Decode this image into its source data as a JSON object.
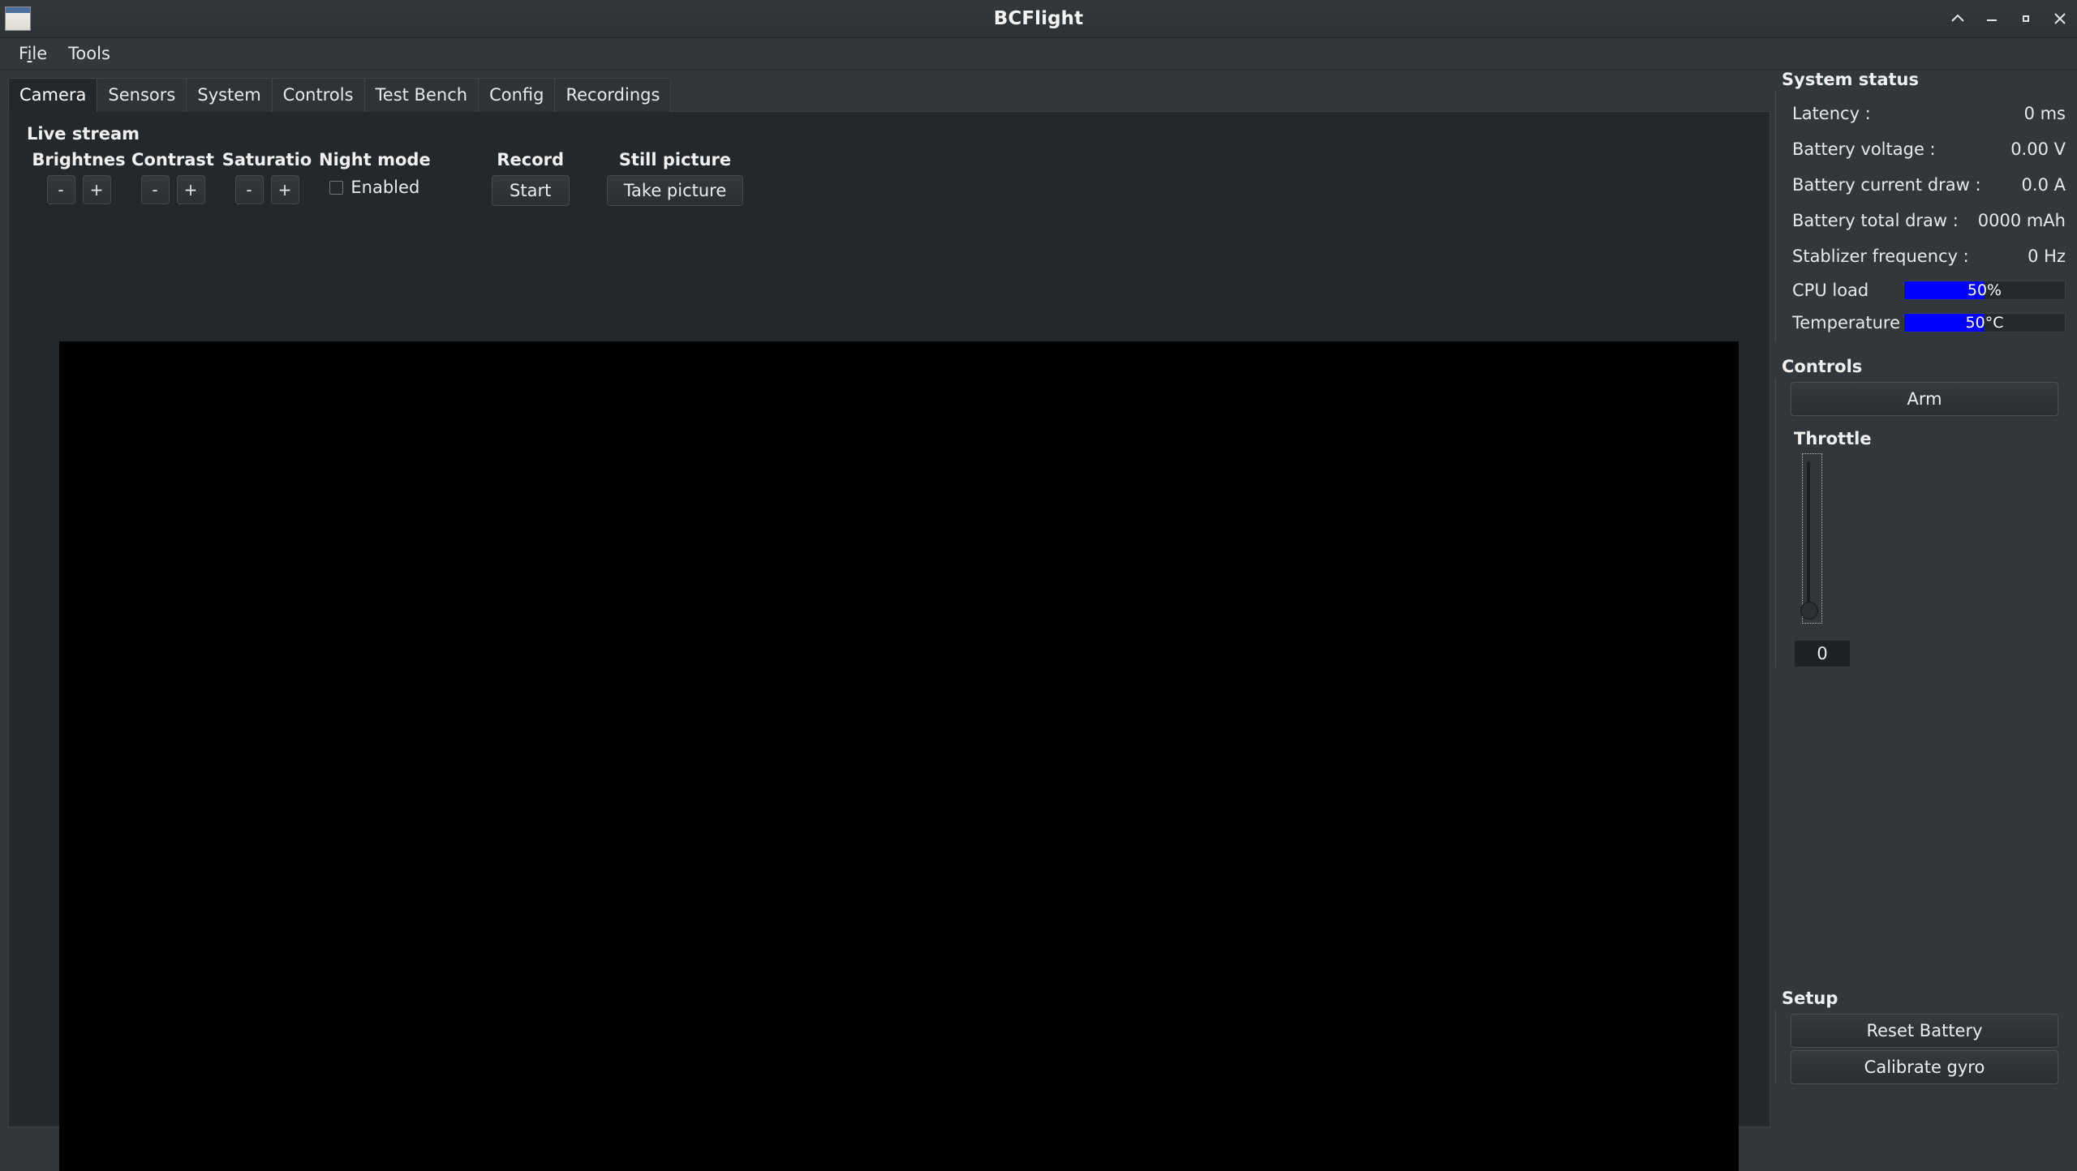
{
  "window": {
    "title": "BCFlight",
    "icon": "application-window-icon",
    "buttons": [
      {
        "name": "shade-button",
        "glyph": "chevron-up"
      },
      {
        "name": "minimize-button",
        "glyph": "minus"
      },
      {
        "name": "maximize-button",
        "glyph": "square"
      },
      {
        "name": "close-button",
        "glyph": "cross"
      }
    ]
  },
  "menubar": {
    "items": [
      {
        "label": "File",
        "mnemonic": "l"
      },
      {
        "label": "Tools",
        "mnemonic": ""
      }
    ]
  },
  "tabs": [
    {
      "label": "Camera",
      "active": true
    },
    {
      "label": "Sensors",
      "active": false
    },
    {
      "label": "System",
      "active": false
    },
    {
      "label": "Controls",
      "active": false
    },
    {
      "label": "Test Bench",
      "active": false
    },
    {
      "label": "Config",
      "active": false
    },
    {
      "label": "Recordings",
      "active": false
    }
  ],
  "camera": {
    "live_stream_title": "Live stream",
    "adjustments": [
      {
        "label": "Brightnes",
        "minus": "-",
        "plus": "+"
      },
      {
        "label": "Contrast",
        "minus": "-",
        "plus": "+"
      },
      {
        "label": "Saturatio",
        "minus": "-",
        "plus": "+"
      }
    ],
    "night_mode": {
      "title": "Night mode",
      "checkbox_label": "Enabled",
      "checked": false
    },
    "record": {
      "title": "Record",
      "button_label": "Start"
    },
    "still_picture": {
      "title": "Still picture",
      "button_label": "Take picture"
    },
    "video_background": "#000000"
  },
  "system_status": {
    "title": "System status",
    "rows": [
      {
        "label": "Latency :",
        "value": "0 ms"
      },
      {
        "label": "Battery voltage :",
        "value": "0.00 V"
      },
      {
        "label": "Battery current draw :",
        "value": "0.0 A"
      },
      {
        "label": "Battery total draw :",
        "value": "0000 mAh"
      },
      {
        "label": "Stablizer frequency :",
        "value": "0 Hz"
      }
    ],
    "bars": [
      {
        "label": "CPU load",
        "text": "50%",
        "percent": 50,
        "color": "#0000ff"
      },
      {
        "label": "Temperature",
        "text": "50°C",
        "percent": 50,
        "color": "#0000ff"
      }
    ]
  },
  "controls": {
    "title": "Controls",
    "arm_label": "Arm",
    "throttle": {
      "title": "Throttle",
      "value": "0",
      "min": 0,
      "max": 100,
      "current": 0
    }
  },
  "setup": {
    "title": "Setup",
    "reset_battery_label": "Reset Battery",
    "calibrate_gyro_label": "Calibrate gyro"
  }
}
